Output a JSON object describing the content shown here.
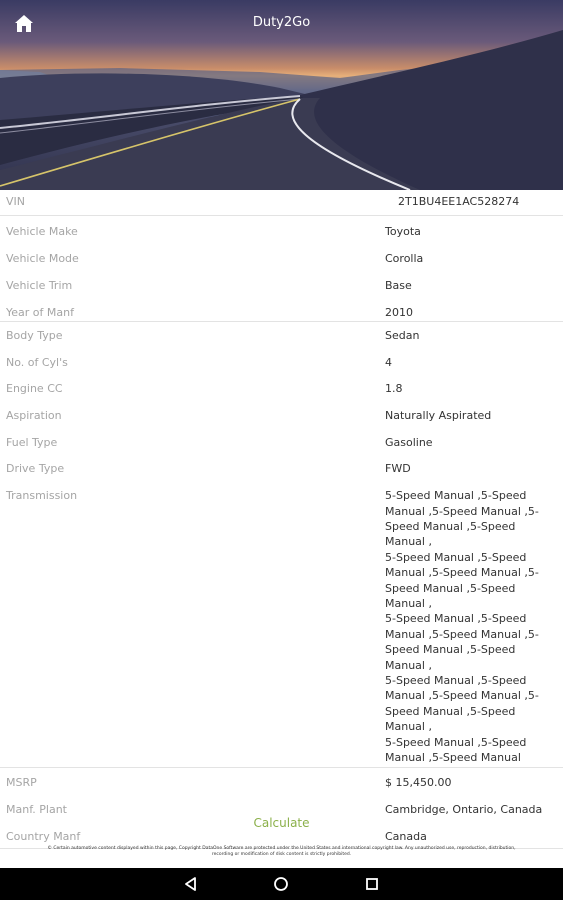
{
  "header": {
    "title": "Duty2Go",
    "home_icon": "home-icon"
  },
  "vehicle": {
    "vin": {
      "label": "VIN",
      "value": "2T1BU4EE1AC528274"
    },
    "make": {
      "label": "Vehicle Make",
      "value": "Toyota"
    },
    "model": {
      "label": "Vehicle Mode",
      "value": "Corolla"
    },
    "trim": {
      "label": "Vehicle Trim",
      "value": "Base"
    },
    "year": {
      "label": "Year of Manf",
      "value": "2010"
    },
    "body_type": {
      "label": "Body Type",
      "value": "Sedan"
    },
    "cylinders": {
      "label": "No. of Cyl's",
      "value": "4"
    },
    "engine_cc": {
      "label": "Engine CC",
      "value": "1.8"
    },
    "aspiration": {
      "label": "Aspiration",
      "value": "Naturally Aspirated"
    },
    "fuel_type": {
      "label": "Fuel Type",
      "value": "Gasoline"
    },
    "drive_type": {
      "label": "Drive Type",
      "value": "FWD"
    },
    "transmission": {
      "label": "Transmission",
      "lines": [
        "5-Speed Manual ,5-Speed",
        "Manual ,5-Speed Manual ,5-",
        "Speed Manual ,5-Speed Manual ,",
        "5-Speed Manual ,5-Speed",
        "Manual ,5-Speed Manual ,5-",
        "Speed Manual ,5-Speed Manual ,",
        "5-Speed Manual ,5-Speed",
        "Manual ,5-Speed Manual ,5-",
        "Speed Manual ,5-Speed Manual ,",
        "5-Speed Manual ,5-Speed",
        "Manual ,5-Speed Manual ,5-",
        "Speed Manual ,5-Speed Manual ,",
        "5-Speed Manual ,5-Speed",
        "Manual ,5-Speed Manual"
      ]
    },
    "msrp": {
      "label": "MSRP",
      "value": "$ 15,450.00"
    },
    "plant": {
      "label": "Manf. Plant",
      "value": "Cambridge, Ontario, Canada"
    },
    "country": {
      "label": "Country Manf",
      "value": "Canada"
    }
  },
  "actions": {
    "calculate_label": "Calculate"
  },
  "disclaimer": {
    "line1": "© Certain automotive content displayed within this page, Copyright DataOne Software are protected under the United States and international copyright law. Any unauthorized use, reproduction, distribution,",
    "line2": "recording or modification of disk content is strictly prohibited."
  },
  "navbar": {
    "back_icon": "back-triangle-icon",
    "home_icon": "home-circle-icon",
    "recents_icon": "recents-square-icon"
  },
  "colors": {
    "accent": "#8bb04a",
    "label": "#a5a5a5",
    "value": "#333333",
    "divider": "#e3e3e3",
    "navbar": "#000000"
  }
}
